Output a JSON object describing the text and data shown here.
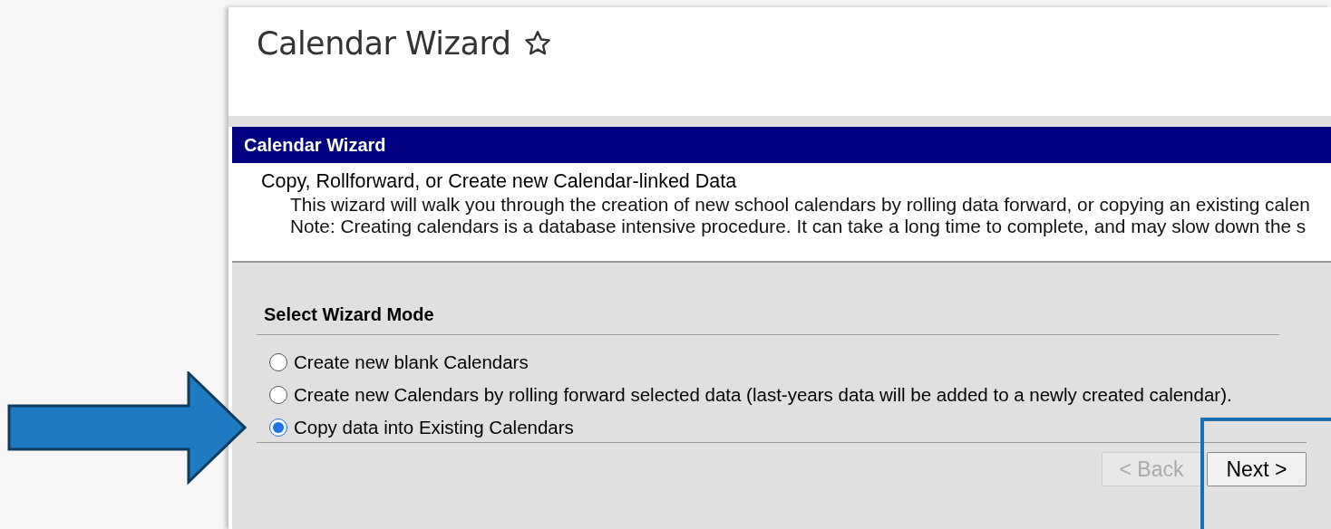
{
  "page": {
    "title": "Calendar Wizard"
  },
  "panel": {
    "title": "Calendar Wizard",
    "heading": "Copy, Rollforward, or Create new Calendar-linked Data",
    "lines": [
      "This wizard will walk you through the creation of new school calendars by rolling data forward, or copying an existing calen",
      "Note: Creating calendars is a database intensive procedure. It can take a long time to complete, and may slow down the s"
    ]
  },
  "mode": {
    "title": "Select Wizard Mode",
    "options": [
      {
        "label": "Create new blank Calendars",
        "selected": false
      },
      {
        "label": "Create new Calendars by rolling forward selected data (last-years data will be added to a newly created calendar).",
        "selected": false
      },
      {
        "label": "Copy data into Existing Calendars",
        "selected": true
      }
    ]
  },
  "buttons": [
    {
      "label": "< Back",
      "disabled": true
    },
    {
      "label": "Next >",
      "disabled": false
    }
  ]
}
